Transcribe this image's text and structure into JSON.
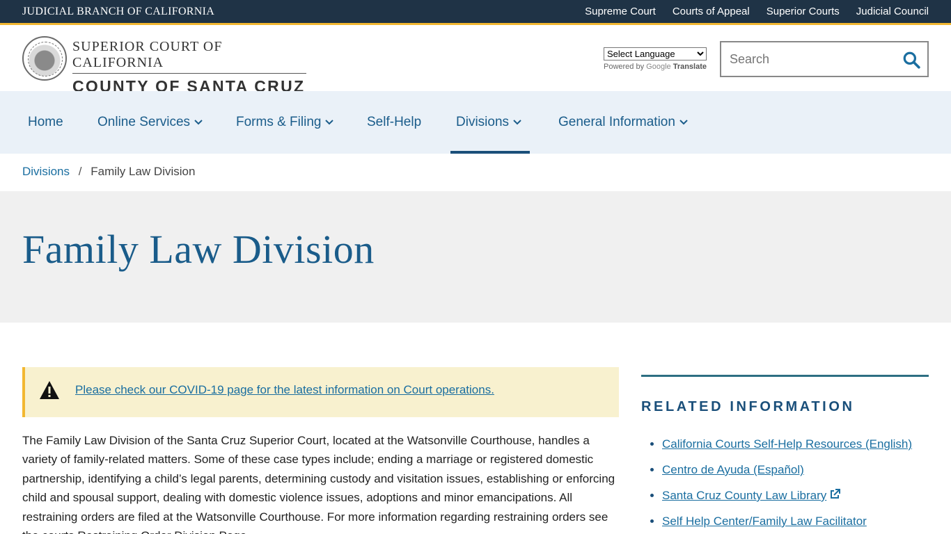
{
  "topbar": {
    "brand": "JUDICIAL BRANCH OF CALIFORNIA",
    "links": [
      "Supreme Court",
      "Courts of Appeal",
      "Superior Courts",
      "Judicial Council"
    ]
  },
  "header": {
    "logo_top": "SUPERIOR COURT OF CALIFORNIA",
    "logo_bottom": "COUNTY OF SANTA CRUZ",
    "translate_select": "Select Language",
    "powered_by": "Powered by",
    "google": "Google",
    "translate": "Translate",
    "search_placeholder": "Search"
  },
  "nav": {
    "items": [
      {
        "label": "Home"
      },
      {
        "label": "Online Services"
      },
      {
        "label": "Forms & Filing"
      },
      {
        "label": "Self-Help"
      },
      {
        "label": "Divisions"
      },
      {
        "label": "General Information"
      }
    ]
  },
  "breadcrumb": {
    "parent": "Divisions",
    "separator": "/",
    "current": "Family Law Division"
  },
  "page": {
    "title": "Family Law Division",
    "alert_link": "Please check our COVID-19 page for the latest information on Court operations.",
    "body": "The Family Law Division of the Santa Cruz Superior Court, located at the Watsonville Courthouse, handles a variety of family-related matters. Some of these case types include; ending a marriage or registered domestic partnership, identifying a child’s legal parents, determining custody and visitation issues, establishing or enforcing child and spousal support, dealing with domestic violence issues, adoptions and minor emancipations. All restraining orders are filed at the Watsonville Courthouse. For more information regarding restraining orders see the courts Restraining Order Division Page."
  },
  "sidebar": {
    "heading": "RELATED INFORMATION",
    "links": [
      "California Courts Self-Help Resources (English)",
      "Centro de Ayuda (Español)",
      "Santa Cruz County Law Library",
      "Self Help Center/Family Law Facilitator"
    ]
  },
  "colors": {
    "topbar_bg": "#1f3346",
    "accent_gold": "#f2b731",
    "nav_bg": "#eaf1f8",
    "link_blue": "#1a6ea0",
    "title_blue": "#1a5c8a",
    "alert_bg": "#f8f1cf"
  }
}
